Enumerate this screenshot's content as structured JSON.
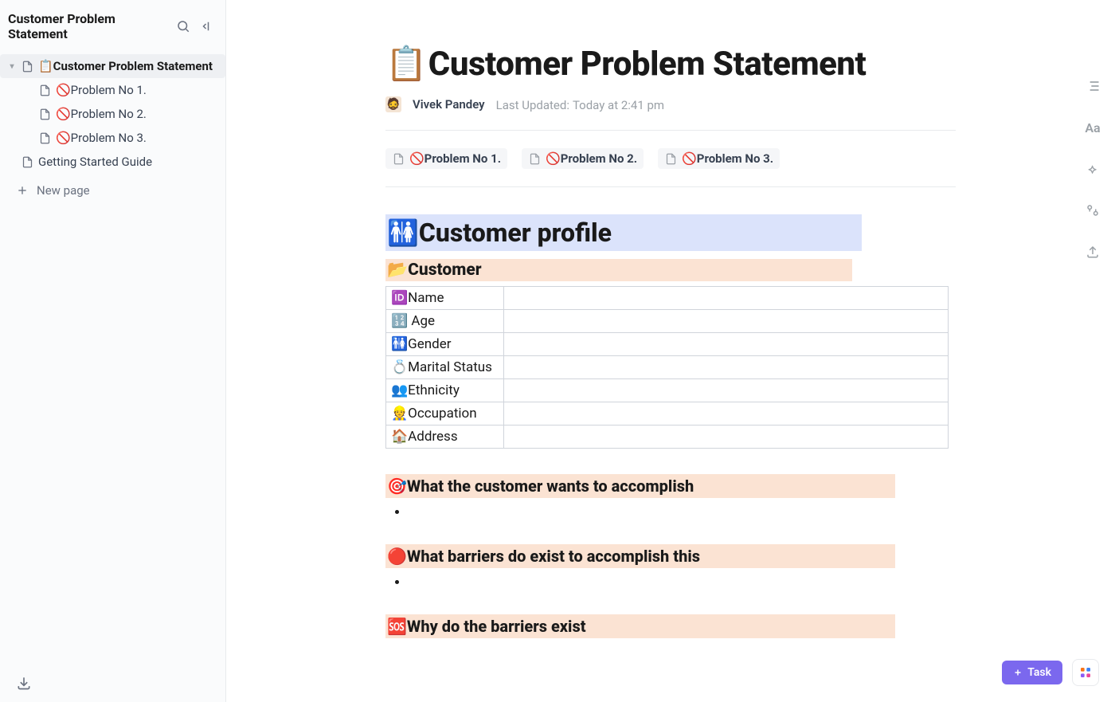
{
  "sidebar": {
    "title": "Customer Problem Statement",
    "items": [
      {
        "emoji": "📋",
        "label": "Customer Problem Statement",
        "selected": true,
        "level": 0,
        "expandable": true
      },
      {
        "emoji": "🚫",
        "label": "Problem No 1.",
        "selected": false,
        "level": 1,
        "expandable": false
      },
      {
        "emoji": "🚫",
        "label": "Problem No 2.",
        "selected": false,
        "level": 1,
        "expandable": false
      },
      {
        "emoji": "🚫",
        "label": "Problem No 3.",
        "selected": false,
        "level": 1,
        "expandable": false
      },
      {
        "emoji": "",
        "label": "Getting Started Guide",
        "selected": false,
        "level": 0,
        "expandable": false
      }
    ],
    "new_page": "New page"
  },
  "page": {
    "title_emoji": "📋",
    "title": "Customer Problem Statement",
    "author": "Vivek Pandey",
    "last_updated_label": "Last Updated:",
    "last_updated_value": "Today at 2:41 pm",
    "chips": [
      {
        "emoji": "🚫",
        "label": "Problem No 1."
      },
      {
        "emoji": "🚫",
        "label": "Problem No 2."
      },
      {
        "emoji": "🚫",
        "label": "Problem No 3."
      }
    ],
    "profile_heading": "🚻Customer profile",
    "customer_heading": "📂Customer",
    "profile_rows": [
      {
        "emoji": "🆔",
        "label": "Name",
        "value": ""
      },
      {
        "emoji": "🔢",
        "label": " Age",
        "value": ""
      },
      {
        "emoji": "🚻",
        "label": "Gender",
        "value": ""
      },
      {
        "emoji": "💍",
        "label": "Marital Status",
        "value": ""
      },
      {
        "emoji": "👥",
        "label": "Ethnicity",
        "value": ""
      },
      {
        "emoji": "👷",
        "label": "Occupation",
        "value": ""
      },
      {
        "emoji": "🏠",
        "label": "Address",
        "value": ""
      }
    ],
    "sec_wants": "🎯What the customer wants to accomplish",
    "sec_barriers": "🔴What barriers do exist to accomplish this",
    "sec_why": "🆘Why do the barriers exist"
  },
  "actions": {
    "task_label": "Task"
  }
}
